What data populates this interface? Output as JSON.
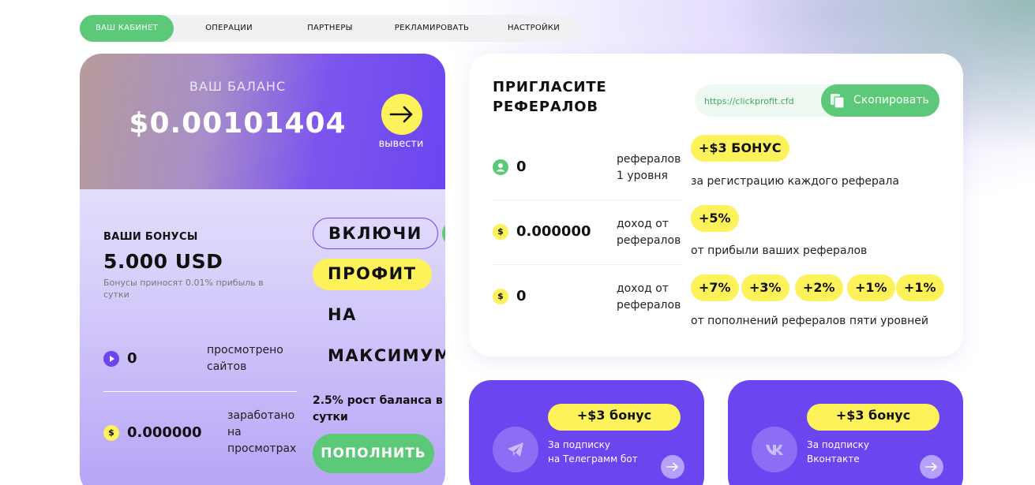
{
  "nav": {
    "tabs": [
      {
        "label": "ВАШ КАБИНЕТ",
        "active": true
      },
      {
        "label": "ОПЕРАЦИИ",
        "active": false
      },
      {
        "label": "ПАРТНЕРЫ",
        "active": false
      },
      {
        "label": "РЕКЛАМИРОВАТЬ",
        "active": false
      },
      {
        "label": "НАСТРОЙКИ",
        "active": false
      }
    ]
  },
  "balance": {
    "label": "ВАШ БАЛАНС",
    "value": "$0.00101404",
    "withdraw_label": "вывести",
    "withdraw_icon": "arrow-right-icon"
  },
  "bonuses": {
    "title": "ВАШИ БОНУСЫ",
    "amount": "5.000 USD",
    "note": "Бонусы приносят 0.01% прибыль в сутки"
  },
  "stats": [
    {
      "icon": "play-icon",
      "value": "0",
      "label_line1": "просмотрено",
      "label_line2": "сайтов",
      "label_line3": ""
    },
    {
      "icon": "dollar-coin-icon",
      "value": "0.000000",
      "label_line1": "заработано",
      "label_line2": "на",
      "label_line3": "просмотрах"
    }
  ],
  "promo": {
    "words": [
      "ВКЛЮЧИ",
      "ПРОФИТ",
      "НА",
      "МАКСИМУМ"
    ],
    "growth_text": "2.5% рост баланса в сутки",
    "topup_label": "ПОПОЛНИТЬ"
  },
  "referrals": {
    "title": "ПРИГЛАСИТЕ РЕФЕРАЛОВ",
    "link_value": "https://clickprofit.cfd",
    "copy_label": "Скопировать",
    "rows": [
      {
        "icon": "user-icon",
        "value": "0",
        "label_line1": "рефералов",
        "label_line2": "1 уровня",
        "badges": [
          "+$3 БОНУС"
        ],
        "description": "за регистрацию каждого реферала"
      },
      {
        "icon": "dollar-coin-icon",
        "value": "0.000000",
        "label_line1": "доход от",
        "label_line2": "рефералов",
        "badges": [
          "+5%"
        ],
        "description": "от прибыли ваших рефералов"
      },
      {
        "icon": "dollar-coin-icon",
        "value": "0",
        "label_line1": "доход от",
        "label_line2": "рефералов",
        "badges": [
          "+7%",
          "+3%",
          "+2%",
          "+1%",
          "+1%"
        ],
        "description": "от пополнений рефералов пяти уровней"
      }
    ]
  },
  "social": [
    {
      "icon": "telegram-icon",
      "badge": "+$3 бонус",
      "line1": "За подписку",
      "line2": "на Телеграмм бот"
    },
    {
      "icon": "vk-icon",
      "badge": "+$3 бонус",
      "line1": "За подписку",
      "line2": "Вконтакте"
    }
  ],
  "colors": {
    "accent_green": "#5cc978",
    "accent_purple": "#6b45f0",
    "accent_yellow": "#fdf25a"
  }
}
